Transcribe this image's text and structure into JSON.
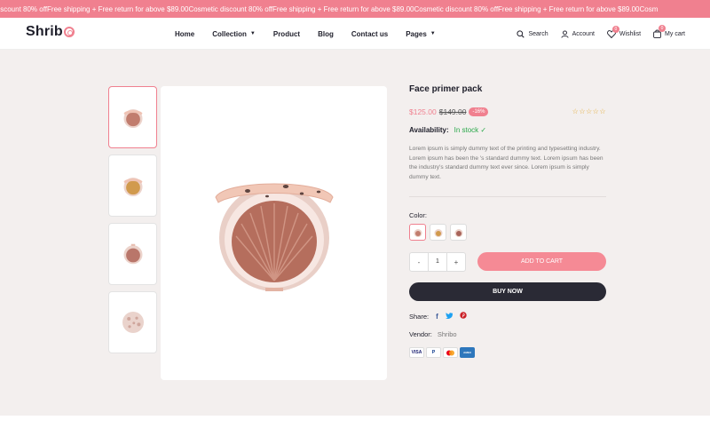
{
  "announcement": {
    "items": [
      "discount 80% off",
      "Free shipping + Free return for above $89.00",
      "Cosmetic discount 80% off",
      "Free shipping + Free return for above $89.00",
      "Cosmetic discount 80% off",
      "Free shipping + Free return for above $89.00",
      "Cosm"
    ]
  },
  "header": {
    "logo": "Shrib",
    "nav": [
      "Home",
      "Collection",
      "Product",
      "Blog",
      "Contact us",
      "Pages"
    ],
    "actions": {
      "search": "Search",
      "account": "Account",
      "wishlist": "Wishlist",
      "wishlist_count": "0",
      "cart": "My cart",
      "cart_count": "0"
    }
  },
  "product": {
    "title": "Face primer pack",
    "price": "$125.00",
    "compare_price": "$149.00",
    "discount": "-16%",
    "rating_stars": "☆☆☆☆☆",
    "availability_label": "Availability:",
    "availability_value": "In stock ✓",
    "description": "Lorem ipsum is simply dummy text of the printing and typesetting industry. Lorem ipsum has been the 's standard dummy text. Lorem ipsum has been the industry's standard dummy text ever since. Lorem ipsum is simply dummy text.",
    "color_label": "Color:",
    "quantity": "1",
    "qty_minus": "-",
    "qty_plus": "+",
    "add_to_cart": "ADD TO CART",
    "buy_now": "BUY NOW",
    "share_label": "Share:",
    "vendor_label": "Vendor:",
    "vendor_value": "Shribo",
    "payment_methods": [
      "VISA",
      "P",
      "MC",
      "AMEX"
    ]
  },
  "colors": {
    "accent": "#f0808f",
    "dark": "#2a2a35",
    "instock": "#2aa84a",
    "background": "#f3efee"
  }
}
